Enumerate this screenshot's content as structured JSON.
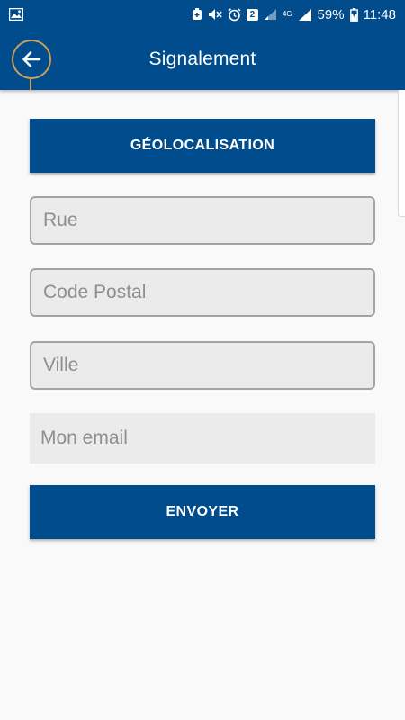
{
  "status_bar": {
    "battery_percent": "59%",
    "time": "11:48",
    "sim_slot": "2",
    "network_type": "4G",
    "icons": [
      "gallery-icon",
      "data-saver-icon",
      "mute-icon",
      "alarm-icon",
      "sim-icon",
      "signal-icon",
      "network-4g-icon",
      "signal-full-icon",
      "battery-charging-icon"
    ]
  },
  "header": {
    "title": "Signalement",
    "back_icon": "arrow-left-icon"
  },
  "form": {
    "geolocation_label": "GÉOLOCALISATION",
    "street_placeholder": "Rue",
    "postal_code_placeholder": "Code Postal",
    "city_placeholder": "Ville",
    "email_placeholder": "Mon email",
    "submit_label": "ENVOYER"
  },
  "colors": {
    "primary": "#004c8c",
    "accent": "#c9a15a",
    "background": "#f9f9f9",
    "field_background": "#ebebeb",
    "field_border": "#a3a3a3"
  }
}
